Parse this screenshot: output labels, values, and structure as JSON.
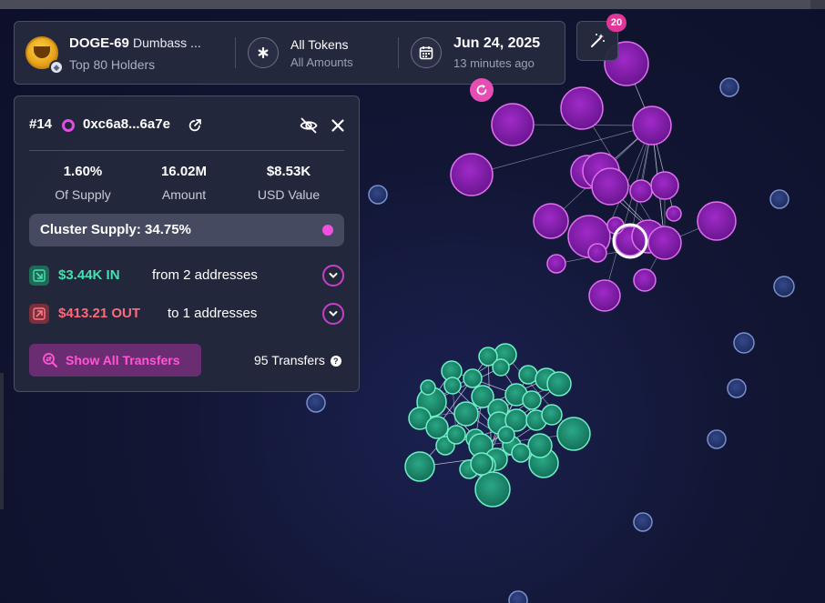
{
  "header": {
    "token_symbol": "DOGE-69",
    "token_name": "Dumbass ...",
    "holders_label": "Top 80 Holders",
    "filter_title": "All Tokens",
    "filter_sub": "All Amounts",
    "date": "Jun 24, 2025",
    "date_sub": "13 minutes ago",
    "magic_badge": "20"
  },
  "panel": {
    "rank": "#14",
    "address": "0xc6a8...6a7e",
    "stats": [
      {
        "value": "1.60%",
        "label": "Of Supply"
      },
      {
        "value": "16.02M",
        "label": "Amount"
      },
      {
        "value": "$8.53K",
        "label": "USD Value"
      }
    ],
    "cluster_supply": "Cluster Supply: 34.75%",
    "in_amount": "$3.44K IN",
    "in_text": "from 2 addresses",
    "out_amount": "$413.21 OUT",
    "out_text": "to 1 addresses",
    "show_button": "Show All Transfers",
    "transfers_count": "95 Transfers"
  },
  "colors": {
    "accent_pink": "#e84db5",
    "purple_node": "#8a1fb0",
    "green_node": "#1e9a78",
    "blue_node": "#2a3d78",
    "in_green": "#44e0b0",
    "out_red": "#ff6a7a"
  },
  "icons": [
    "ethereum-icon",
    "asterisk-icon",
    "calendar-icon",
    "magic-wand-icon",
    "refresh-icon",
    "external-link-icon",
    "eye-off-icon",
    "close-icon",
    "arrow-in-icon",
    "arrow-out-icon",
    "chevron-down-icon",
    "search-transfers-icon",
    "help-icon"
  ]
}
